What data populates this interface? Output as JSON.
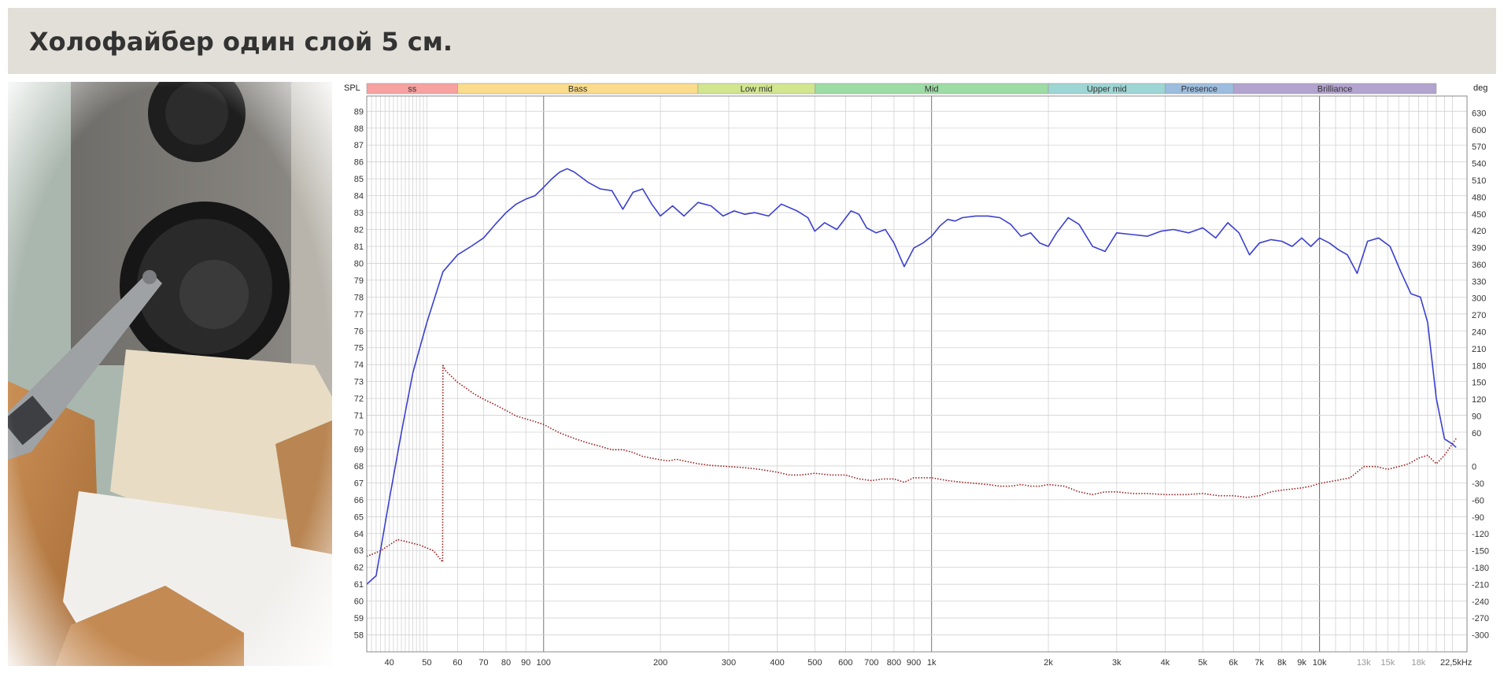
{
  "page": {
    "title": "Холофайбер один слой 5 см."
  },
  "photo": {
    "subject": "speaker-with-measurement-microphone-on-fiber-padding"
  },
  "chart_data": {
    "type": "line",
    "xscale": "log",
    "xlim": [
      35,
      24000
    ],
    "ylim": [
      57,
      89.9
    ],
    "ylabel_left": "SPL",
    "ylabel_right": "deg",
    "y2lim": [
      -330,
      660
    ],
    "grid": true,
    "bands": [
      {
        "label": "ss",
        "from": 35,
        "to": 60,
        "color": "#f7a1a1"
      },
      {
        "label": "Bass",
        "from": 60,
        "to": 250,
        "color": "#fadc8c"
      },
      {
        "label": "Low mid",
        "from": 250,
        "to": 500,
        "color": "#d2e68f"
      },
      {
        "label": "Mid",
        "from": 500,
        "to": 2000,
        "color": "#9ddca5"
      },
      {
        "label": "Upper mid",
        "from": 2000,
        "to": 4000,
        "color": "#9dd6d4"
      },
      {
        "label": "Presence",
        "from": 4000,
        "to": 6000,
        "color": "#9dbdde"
      },
      {
        "label": "Brilliance",
        "from": 6000,
        "to": 20000,
        "color": "#b2a3cf"
      }
    ],
    "x_ticks": [
      {
        "v": 40,
        "l": "40"
      },
      {
        "v": 50,
        "l": "50"
      },
      {
        "v": 60,
        "l": "60"
      },
      {
        "v": 70,
        "l": "70"
      },
      {
        "v": 80,
        "l": "80"
      },
      {
        "v": 90,
        "l": "90"
      },
      {
        "v": 100,
        "l": "100"
      },
      {
        "v": 200,
        "l": "200"
      },
      {
        "v": 300,
        "l": "300"
      },
      {
        "v": 400,
        "l": "400"
      },
      {
        "v": 500,
        "l": "500"
      },
      {
        "v": 600,
        "l": "600"
      },
      {
        "v": 700,
        "l": "700"
      },
      {
        "v": 800,
        "l": "800"
      },
      {
        "v": 900,
        "l": "900"
      },
      {
        "v": 1000,
        "l": "1k"
      },
      {
        "v": 2000,
        "l": "2k"
      },
      {
        "v": 3000,
        "l": "3k"
      },
      {
        "v": 4000,
        "l": "4k"
      },
      {
        "v": 5000,
        "l": "5k"
      },
      {
        "v": 6000,
        "l": "6k"
      },
      {
        "v": 7000,
        "l": "7k"
      },
      {
        "v": 8000,
        "l": "8k"
      },
      {
        "v": 9000,
        "l": "9k"
      },
      {
        "v": 10000,
        "l": "10k"
      },
      {
        "v": 13000,
        "l": "13k",
        "dim": true
      },
      {
        "v": 15000,
        "l": "15k",
        "dim": true
      },
      {
        "v": 18000,
        "l": "18k",
        "dim": true
      },
      {
        "v": 22500,
        "l": "22,5kHz"
      }
    ],
    "y_ticks": [
      89,
      88,
      87,
      86,
      85,
      84,
      83,
      82,
      81,
      80,
      79,
      78,
      77,
      76,
      75,
      74,
      73,
      72,
      71,
      70,
      69,
      68,
      67,
      66,
      65,
      64,
      63,
      62,
      61,
      60,
      59,
      58
    ],
    "y2_ticks": [
      630,
      600,
      570,
      540,
      510,
      480,
      450,
      420,
      390,
      360,
      330,
      300,
      270,
      240,
      210,
      180,
      150,
      120,
      90,
      60,
      0,
      -30,
      -60,
      -90,
      -120,
      -150,
      -180,
      -210,
      -240,
      -270,
      -300
    ],
    "series": [
      {
        "role": "spl",
        "color": "#3a3fd0",
        "style": "solid",
        "x": [
          35,
          37,
          40,
          43,
          46,
          50,
          55,
          60,
          65,
          70,
          75,
          80,
          85,
          90,
          95,
          100,
          105,
          110,
          115,
          120,
          130,
          140,
          150,
          160,
          170,
          180,
          190,
          200,
          215,
          230,
          250,
          270,
          290,
          310,
          330,
          350,
          380,
          410,
          450,
          480,
          500,
          530,
          570,
          620,
          650,
          680,
          720,
          760,
          800,
          850,
          900,
          950,
          1000,
          1050,
          1100,
          1150,
          1200,
          1300,
          1400,
          1500,
          1600,
          1700,
          1800,
          1900,
          2000,
          2100,
          2250,
          2400,
          2600,
          2800,
          3000,
          3300,
          3600,
          3900,
          4200,
          4600,
          5000,
          5400,
          5800,
          6200,
          6600,
          7000,
          7500,
          8000,
          8500,
          9000,
          9500,
          10000,
          10600,
          11200,
          11800,
          12500,
          13300,
          14200,
          15200,
          16200,
          17200,
          18200,
          19000,
          20000,
          21000,
          22000,
          22500
        ],
        "y": [
          61.0,
          61.5,
          66.0,
          70.0,
          73.5,
          76.5,
          79.5,
          80.5,
          81.0,
          81.5,
          82.3,
          83.0,
          83.5,
          83.8,
          84.0,
          84.5,
          85.0,
          85.4,
          85.6,
          85.4,
          84.8,
          84.4,
          84.3,
          83.2,
          84.2,
          84.4,
          83.5,
          82.8,
          83.4,
          82.8,
          83.6,
          83.4,
          82.8,
          83.1,
          82.9,
          83.0,
          82.8,
          83.5,
          83.1,
          82.7,
          81.9,
          82.4,
          82.0,
          83.1,
          82.9,
          82.1,
          81.8,
          82.0,
          81.2,
          79.8,
          80.9,
          81.2,
          81.6,
          82.2,
          82.6,
          82.5,
          82.7,
          82.8,
          82.8,
          82.7,
          82.3,
          81.6,
          81.8,
          81.2,
          81.0,
          81.8,
          82.7,
          82.3,
          81.0,
          80.7,
          81.8,
          81.7,
          81.6,
          81.9,
          82.0,
          81.8,
          82.1,
          81.5,
          82.4,
          81.8,
          80.5,
          81.2,
          81.4,
          81.3,
          81.0,
          81.5,
          81.0,
          81.5,
          81.2,
          80.8,
          80.5,
          79.4,
          81.3,
          81.5,
          81.0,
          79.5,
          78.2,
          78.0,
          76.5,
          72.0,
          69.6,
          69.3,
          69.1
        ]
      },
      {
        "role": "phase",
        "color": "#9a1b1b",
        "style": "dotted",
        "x": [
          35,
          38,
          40,
          42,
          45,
          48,
          52,
          54.9,
          55,
          56,
          58,
          60,
          63,
          66,
          70,
          75,
          80,
          85,
          90,
          95,
          100,
          110,
          120,
          130,
          140,
          150,
          160,
          170,
          180,
          190,
          200,
          210,
          220,
          230,
          250,
          270,
          300,
          330,
          360,
          400,
          430,
          460,
          500,
          550,
          600,
          650,
          700,
          750,
          800,
          850,
          900,
          950,
          1000,
          1100,
          1200,
          1300,
          1400,
          1500,
          1600,
          1700,
          1800,
          1900,
          2000,
          2200,
          2400,
          2600,
          2800,
          3000,
          3300,
          3600,
          4000,
          4500,
          5000,
          5500,
          6000,
          6500,
          7000,
          7500,
          8000,
          8500,
          9000,
          9500,
          10000,
          11000,
          12000,
          13000,
          14000,
          15000,
          16000,
          17000,
          18000,
          19000,
          20000,
          21000,
          22500
        ],
        "y": [
          -160,
          -150,
          -140,
          -130,
          -135,
          -140,
          -150,
          -170,
          180,
          170,
          160,
          150,
          140,
          130,
          120,
          110,
          100,
          90,
          85,
          80,
          75,
          60,
          50,
          42,
          36,
          30,
          30,
          25,
          18,
          15,
          12,
          10,
          13,
          10,
          5,
          2,
          0,
          -2,
          -5,
          -10,
          -15,
          -15,
          -12,
          -15,
          -15,
          -22,
          -25,
          -22,
          -22,
          -28,
          -20,
          -20,
          -20,
          -25,
          -28,
          -30,
          -32,
          -35,
          -35,
          -32,
          -35,
          -35,
          -32,
          -35,
          -45,
          -50,
          -45,
          -45,
          -48,
          -48,
          -50,
          -50,
          -48,
          -52,
          -52,
          -55,
          -52,
          -45,
          -42,
          -40,
          -38,
          -35,
          -30,
          -25,
          -20,
          0,
          0,
          -5,
          0,
          5,
          15,
          20,
          5,
          20,
          50
        ]
      }
    ]
  }
}
